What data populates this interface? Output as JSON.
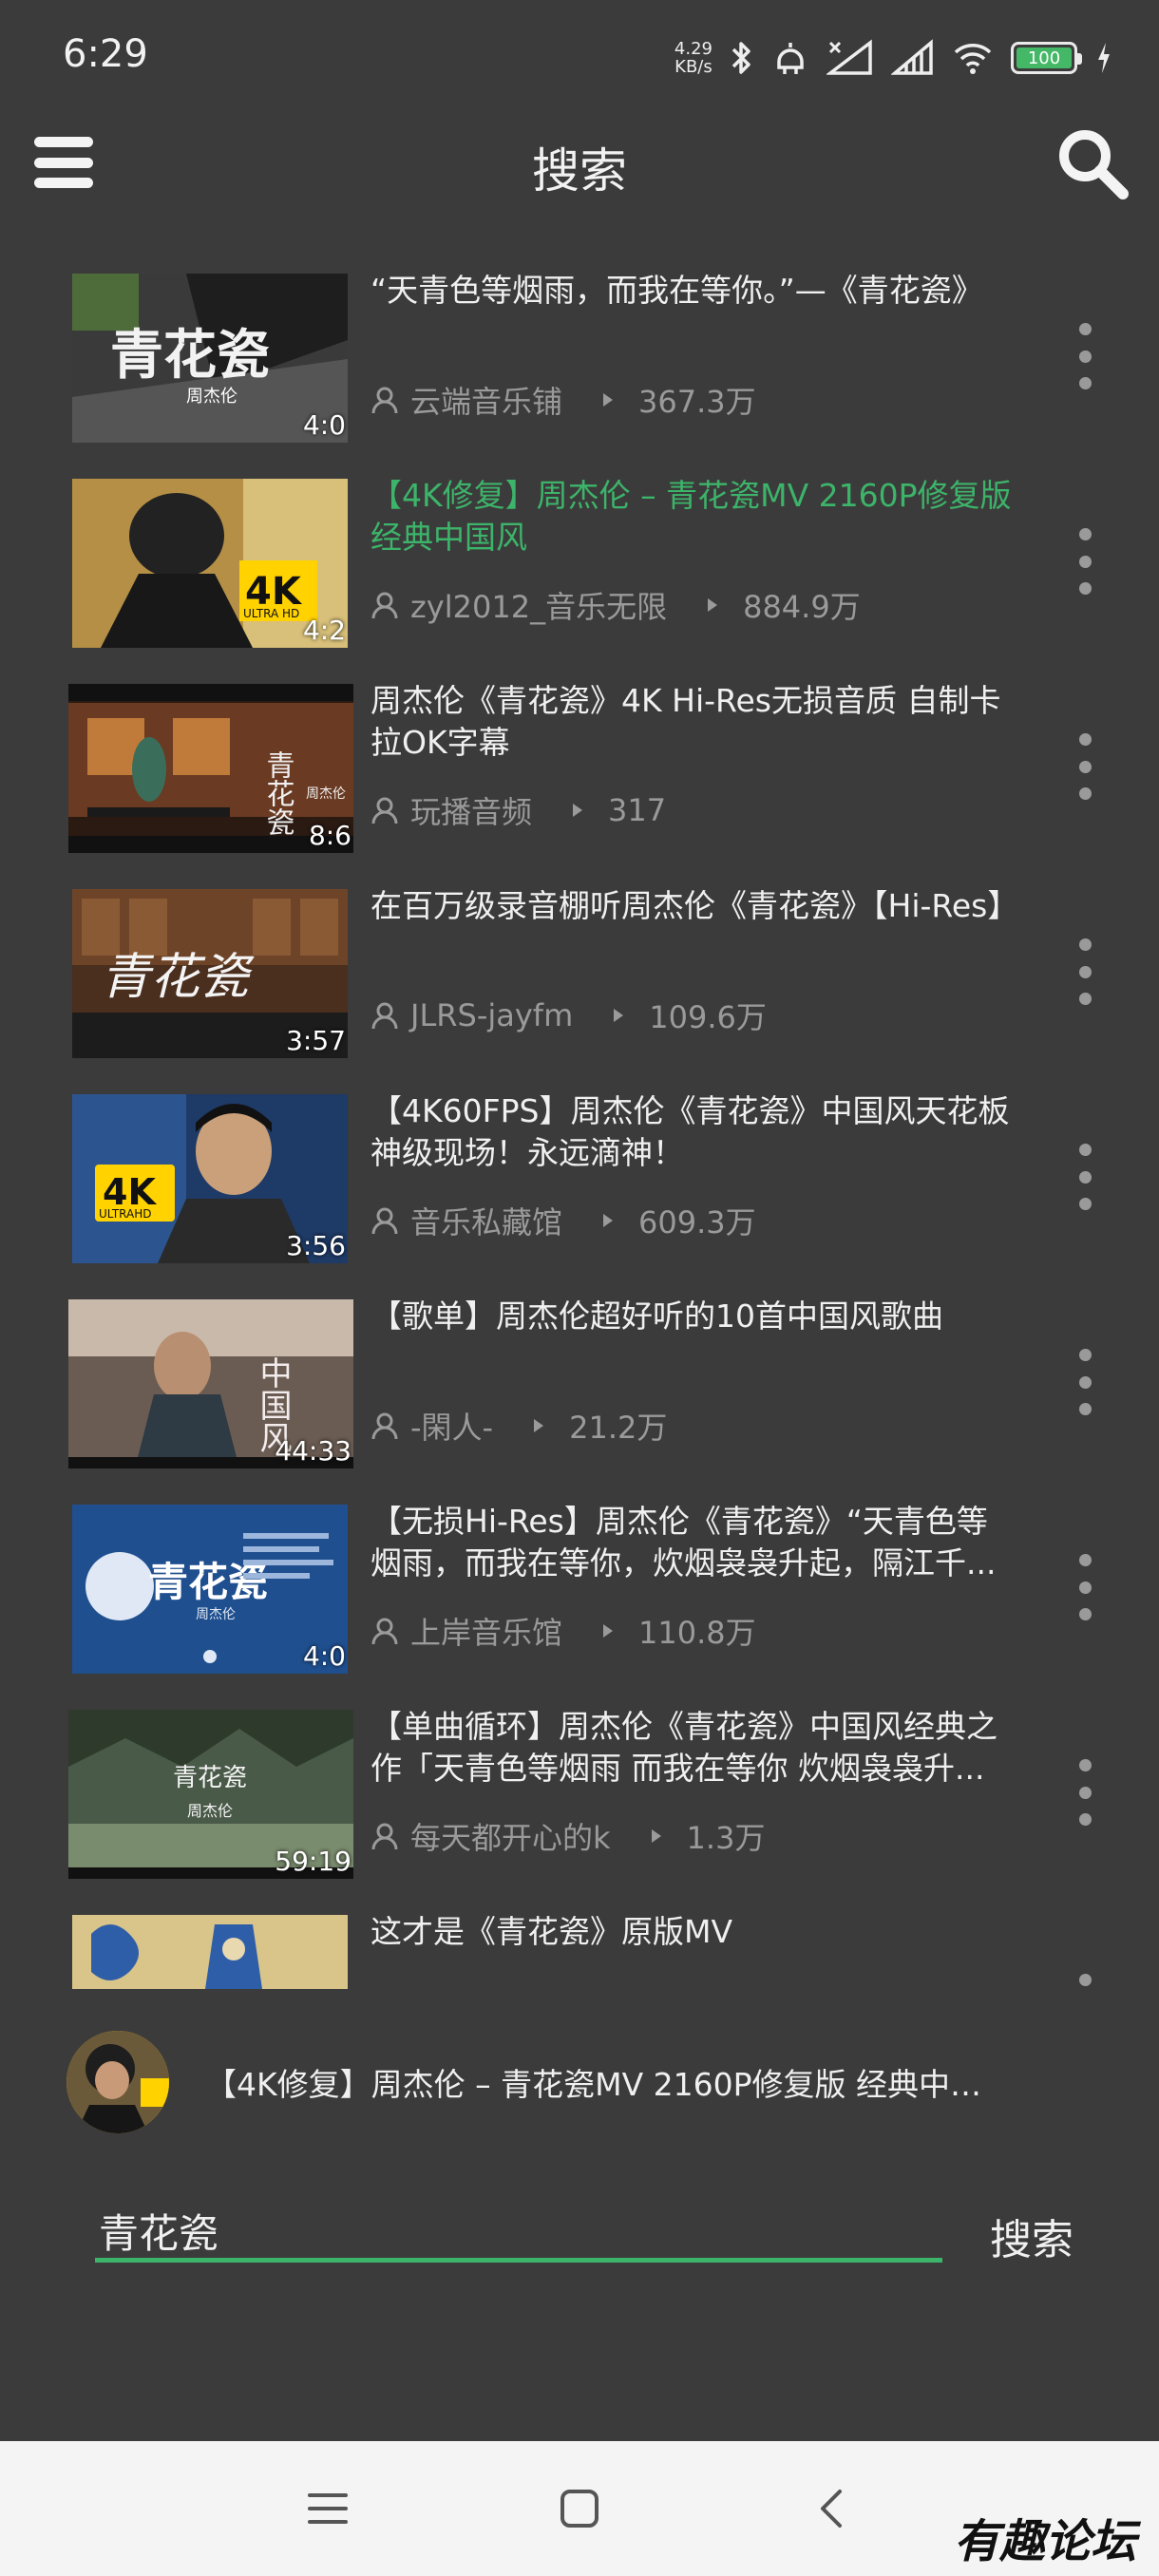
{
  "status_bar": {
    "time": "6:29",
    "net_speed_value": "4.29",
    "net_speed_unit": "KB/s",
    "battery": "100",
    "icons": [
      "bluetooth-icon",
      "alarm-icon",
      "signal-icon",
      "signal-icon",
      "wifi-icon",
      "battery-icon",
      "charging-icon"
    ]
  },
  "app_bar": {
    "title": "搜索",
    "menu_icon": "hamburger-menu-icon",
    "search_icon": "search-icon"
  },
  "results": [
    {
      "title": "“天青色等烟雨，而我在等你。”—《青花瓷》",
      "uploader": "云端音乐铺",
      "plays": "367.3万",
      "duration": "4:0",
      "active": false
    },
    {
      "title": "【4K修复】周杰伦 – 青花瓷MV 2160P修复版 经典中国风",
      "uploader": "zyl2012_音乐无限",
      "plays": "884.9万",
      "duration": "4:2",
      "active": true
    },
    {
      "title": "周杰伦《青花瓷》4K Hi-Res无损音质 自制卡拉OK字幕",
      "uploader": "玩播音频",
      "plays": "317",
      "duration": "8:6",
      "active": false
    },
    {
      "title": "在百万级录音棚听周杰伦《青花瓷》【Hi-Res】",
      "uploader": "JLRS-jayfm",
      "plays": "109.6万",
      "duration": "3:57",
      "active": false
    },
    {
      "title": "【4K60FPS】周杰伦《青花瓷》中国风天花板神级现场！永远滴神！",
      "uploader": "音乐私藏馆",
      "plays": "609.3万",
      "duration": "3:56",
      "active": false
    },
    {
      "title": "【歌单】周杰伦超好听的10首中国风歌曲",
      "uploader": "-閑人-",
      "plays": "21.2万",
      "duration": "44:33",
      "active": false
    },
    {
      "title": "【无损Hi-Res】周杰伦《青花瓷》“天青色等烟雨，而我在等你，炊烟袅袅升起，隔江千...",
      "uploader": "上岸音乐馆",
      "plays": "110.8万",
      "duration": "4:0",
      "active": false
    },
    {
      "title": "【单曲循环】周杰伦《青花瓷》中国风经典之作「天青色等烟雨 而我在等你 炊烟袅袅升...",
      "uploader": "每天都开心的k",
      "plays": "1.3万",
      "duration": "59:19",
      "active": false
    },
    {
      "title": "这才是《青花瓷》原版MV",
      "uploader": "",
      "plays": "",
      "duration": "",
      "active": false
    }
  ],
  "thumbnails": {
    "t1_text": "青花瓷",
    "t1_sub": "周杰伦",
    "t2_badge": "4K",
    "t2_badge_sub": "ULTRA HD",
    "t3_text": "青花瓷",
    "t3_sub": "周杰伦",
    "t4_text": "青花瓷",
    "t5_badge": "4K",
    "t5_badge_sub": "ULTRAHD",
    "t6_text": "中国风",
    "t7_text": "青花瓷",
    "t7_sub": "周杰伦",
    "t8_text": "青花瓷",
    "t8_sub": "周杰伦"
  },
  "now_playing": {
    "title": "【4K修复】周杰伦 – 青花瓷MV 2160P修复版 经典中…"
  },
  "search": {
    "value": "青花瓷",
    "button": "搜索"
  },
  "nav_bar": {
    "icons": [
      "recents-icon",
      "home-icon",
      "back-icon"
    ]
  },
  "watermark": "有趣论坛",
  "colors": {
    "accent": "#3cb46a",
    "background": "#3c3b3b"
  }
}
